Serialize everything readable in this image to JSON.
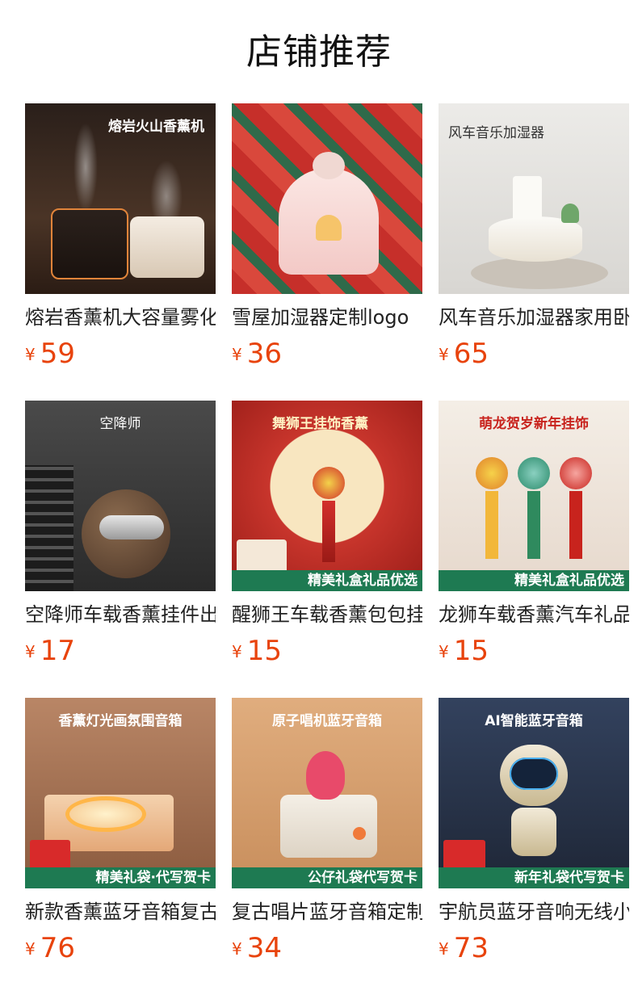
{
  "page": {
    "title": "店铺推荐"
  },
  "products": [
    {
      "image_tag": "熔岩火山香薰机",
      "image_banner": "",
      "name": "熔岩香薰机大容量雾化",
      "currency": "¥",
      "price": "59",
      "bg": "#3a2a20",
      "tag_color": "#ffffff"
    },
    {
      "image_tag": "",
      "image_banner": "",
      "name": "雪屋加湿器定制logo",
      "currency": "¥",
      "price": "36",
      "bg": "#c62f2a",
      "tag_color": "#ffffff"
    },
    {
      "image_tag": "风车音乐加湿器",
      "image_banner": "",
      "name": "风车音乐加湿器家用卧",
      "currency": "¥",
      "price": "65",
      "bg": "#e6e4e0",
      "tag_color": "#333333"
    },
    {
      "image_tag": "空降师",
      "image_banner": "",
      "name": "空降师车载香薰挂件出",
      "currency": "¥",
      "price": "17",
      "bg": "#3b3b3b",
      "tag_color": "#ffffff"
    },
    {
      "image_tag": "舞狮王挂饰香薰",
      "image_banner": "精美礼盒礼品优选",
      "name": "醒狮王车载香薰包包挂",
      "currency": "¥",
      "price": "15",
      "bg": "#b5231f",
      "tag_color": "#fff3c4"
    },
    {
      "image_tag": "萌龙贺岁新年挂饰",
      "image_banner": "精美礼盒礼品优选",
      "name": "龙狮车载香薰汽车礼品",
      "currency": "¥",
      "price": "15",
      "bg": "#f0e8e0",
      "tag_color": "#c8231d"
    },
    {
      "image_tag": "香薰灯光画氛围音箱",
      "image_banner": "精美礼袋·代写贺卡",
      "name": "新款香薰蓝牙音箱复古",
      "currency": "¥",
      "price": "76",
      "bg": "#a4684a",
      "tag_color": "#ffffff"
    },
    {
      "image_tag": "原子唱机蓝牙音箱",
      "image_banner": "公仔礼袋代写贺卡",
      "name": "复古唱片蓝牙音箱定制",
      "currency": "¥",
      "price": "34",
      "bg": "#d8a272",
      "tag_color": "#ffffff"
    },
    {
      "image_tag": "AI智能蓝牙音箱",
      "image_banner": "新年礼袋代写贺卡",
      "name": "宇航员蓝牙音响无线小",
      "currency": "¥",
      "price": "73",
      "bg": "#2e3c56",
      "tag_color": "#ffffff"
    }
  ]
}
